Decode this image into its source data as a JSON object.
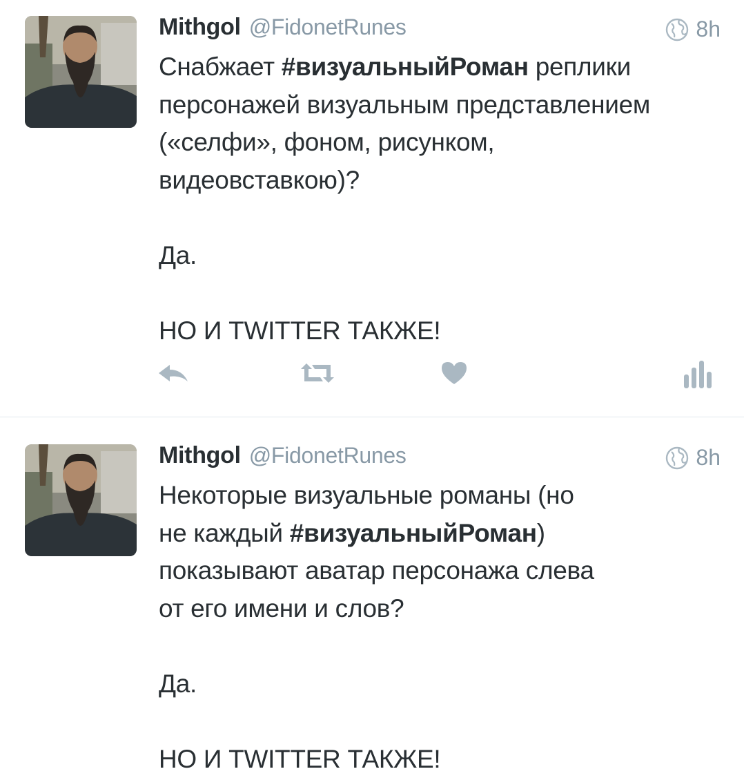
{
  "tweets": [
    {
      "user": {
        "name": "Mithgol",
        "handle": "@FidonetRunes"
      },
      "time": "8h",
      "body_lines": [
        {
          "pre": "Снабжает ",
          "tag": "#визуальныйРоман",
          "post": " реплики"
        },
        {
          "pre": "персонажей визуальным представлением",
          "tag": "",
          "post": ""
        },
        {
          "pre": "(«селфи», фоном, рисунком,",
          "tag": "",
          "post": ""
        },
        {
          "pre": "видеовставкою)?",
          "tag": "",
          "post": ""
        },
        {
          "pre": "",
          "tag": "",
          "post": ""
        },
        {
          "pre": "Да.",
          "tag": "",
          "post": ""
        },
        {
          "pre": "",
          "tag": "",
          "post": ""
        },
        {
          "pre": "НО И TWITTER ТАКЖЕ!",
          "tag": "",
          "post": ""
        }
      ],
      "actions": [
        "reply-icon",
        "retweet-icon",
        "like-icon",
        "analytics-icon"
      ]
    },
    {
      "user": {
        "name": "Mithgol",
        "handle": "@FidonetRunes"
      },
      "time": "8h",
      "body_lines": [
        {
          "pre": "Некоторые визуальные романы (но",
          "tag": "",
          "post": ""
        },
        {
          "pre": "не каждый ",
          "tag": "#визуальныйРоман",
          "post": ")"
        },
        {
          "pre": "показывают аватар персонажа слева",
          "tag": "",
          "post": ""
        },
        {
          "pre": "от его имени и слов?",
          "tag": "",
          "post": ""
        },
        {
          "pre": "",
          "tag": "",
          "post": ""
        },
        {
          "pre": "Да.",
          "tag": "",
          "post": ""
        },
        {
          "pre": "",
          "tag": "",
          "post": ""
        },
        {
          "pre": "НО И TWITTER ТАКЖЕ!",
          "tag": "",
          "post": ""
        }
      ]
    }
  ],
  "colors": {
    "text": "#292f33",
    "secondary": "#8899a6",
    "action_icons": "#aab8c2",
    "divider": "#e1e8ed"
  }
}
